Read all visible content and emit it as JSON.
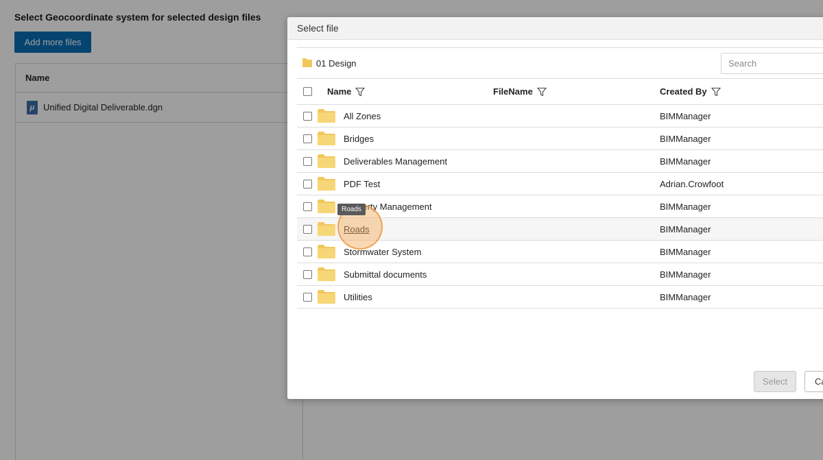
{
  "background": {
    "title": "Select Geocoordinate system for selected design files",
    "add_button": "Add more files",
    "table_header": "Name",
    "files": [
      {
        "name": "Unified Digital Deliverable.dgn",
        "icon": "dgn-file-icon"
      }
    ]
  },
  "modal": {
    "title": "Select file",
    "breadcrumb": "01 Design",
    "search_placeholder": "Search",
    "columns": {
      "name": "Name",
      "filename": "FileName",
      "created_by": "Created By"
    },
    "rows": [
      {
        "name": "All Zones",
        "created_by": "BIMManager"
      },
      {
        "name": "Bridges",
        "created_by": "BIMManager"
      },
      {
        "name": "Deliverables Management",
        "created_by": "BIMManager"
      },
      {
        "name": "PDF Test",
        "created_by": "Adrian.Crowfoot"
      },
      {
        "name": "Property Management",
        "created_by": "BIMManager"
      },
      {
        "name": "Roads",
        "created_by": "BIMManager"
      },
      {
        "name": "Stormwater System",
        "created_by": "BIMManager"
      },
      {
        "name": "Submittal documents",
        "created_by": "BIMManager"
      },
      {
        "name": "Utilities",
        "created_by": "BIMManager"
      }
    ],
    "tooltip": "Roads",
    "select_button": "Select",
    "cancel_button": "Cancel"
  },
  "colors": {
    "primary_button": "#0a6fb5",
    "folder": "#f2c75c",
    "click_indicator": "#f5aa5a"
  }
}
